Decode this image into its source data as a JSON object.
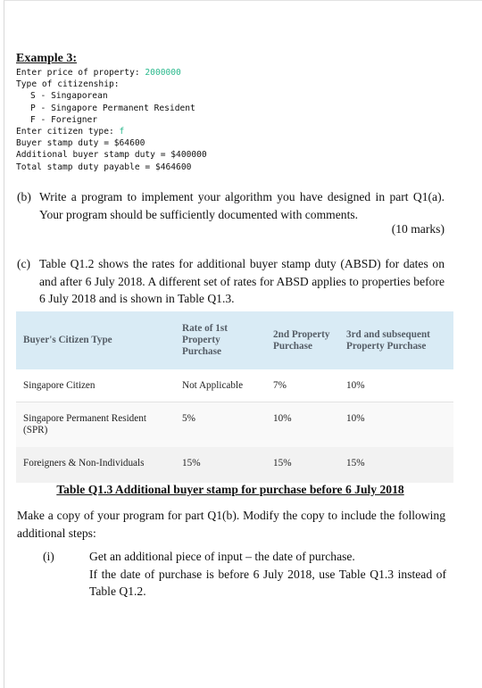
{
  "example": {
    "title": "Example 3:",
    "console": {
      "price_prompt": "Enter price of property: ",
      "price_value": "2000000",
      "citizenship_heading": "Type of citizenship:",
      "options": [
        "S - Singaporean",
        "P - Singapore Permanent Resident",
        "F - Foreigner"
      ],
      "type_prompt": "Enter citizen type: ",
      "type_value": "f",
      "buyer_stamp_duty": "Buyer stamp duty = $64600",
      "additional_stamp_duty": "Additional buyer stamp duty = $400000",
      "total_payable": "Total stamp duty payable = $464600"
    }
  },
  "part_b": {
    "label": "(b)",
    "text": "Write a program to implement your algorithm you have designed in part Q1(a). Your program should be sufficiently documented with comments.",
    "marks": "(10 marks)"
  },
  "part_c": {
    "label": "(c)",
    "text": "Table Q1.2 shows the rates for additional buyer stamp duty (ABSD) for dates on and after 6 July 2018. A different set of rates for ABSD applies to properties before 6 July 2018 and is shown in Table Q1.3."
  },
  "table": {
    "headers": [
      "Buyer's Citizen Type",
      "Rate of 1st Property Purchase",
      "2nd Property Purchase",
      "3rd and subsequent Property Purchase"
    ],
    "rows": [
      [
        "Singapore Citizen",
        "Not Applicable",
        "7%",
        "10%"
      ],
      [
        "Singapore Permanent Resident (SPR)",
        "5%",
        "10%",
        "10%"
      ],
      [
        "Foreigners & Non-Individuals",
        "15%",
        "15%",
        "15%"
      ]
    ],
    "caption": "Table Q1.3 Additional buyer stamp for purchase before 6 July 2018"
  },
  "instructions": {
    "text": "Make a copy of your program for part Q1(b). Modify the copy to include the following additional steps:",
    "steps": [
      {
        "label": "(i)",
        "lines": [
          "Get an additional piece of input – the date of purchase.",
          "If the date of purchase is before 6 July 2018, use Table Q1.3 instead of Table Q1.2."
        ]
      }
    ]
  },
  "colors": {
    "console_input": "#2bb98d",
    "table_header_bg": "#d9ebf5",
    "table_header_text": "#555d66"
  }
}
